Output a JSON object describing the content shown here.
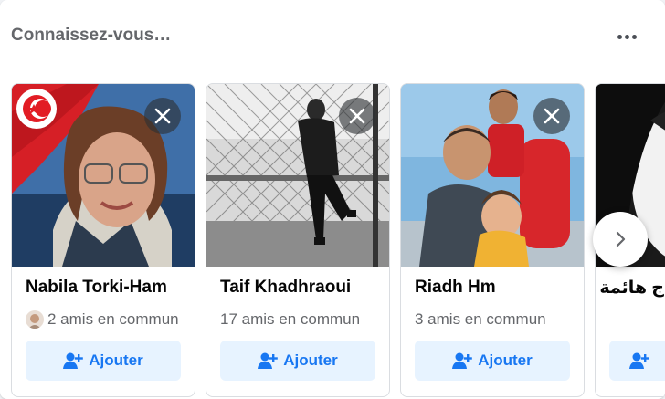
{
  "header": {
    "title": "Connaissez-vous…",
    "more_icon": "more-horizontal-icon"
  },
  "colors": {
    "add_button_bg": "#e7f3ff",
    "add_button_text": "#1877f2",
    "secondary_text": "#65676b"
  },
  "cards": [
    {
      "name": "Nabila Torki-Ham",
      "mutual": "2 amis en commun",
      "add_label": "Ajouter",
      "has_mutual_avatar": true
    },
    {
      "name": "Taif Khadhraoui",
      "mutual": "17 amis en commun",
      "add_label": "Ajouter"
    },
    {
      "name": "Riadh Hm",
      "mutual": "3 amis en commun",
      "add_label": "Ajouter"
    },
    {
      "name": "ج هائمة",
      "mutual": "",
      "add_label": ""
    }
  ],
  "navigation": {
    "next_icon": "chevron-right-icon"
  }
}
